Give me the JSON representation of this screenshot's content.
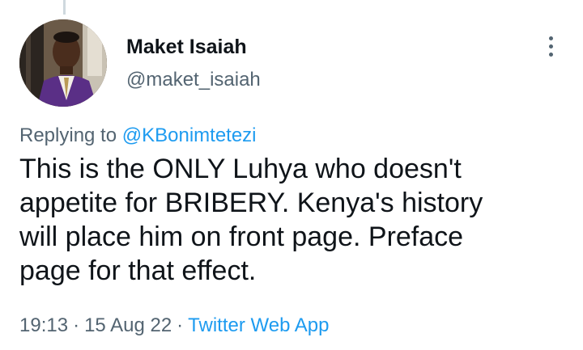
{
  "author": {
    "name": "Maket Isaiah",
    "handle": "@maket_isaiah"
  },
  "reply": {
    "prefix": "Replying to",
    "mention": "@KBonimtetezi"
  },
  "tweet": {
    "line1": "This is the ONLY Luhya who doesn't",
    "line2": "appetite for BRIBERY. Kenya's history",
    "line3": "will place him on front page. Preface",
    "line4": "page for that effect."
  },
  "meta": {
    "time": "19:13",
    "separator": "·",
    "date": "15 Aug 22",
    "source": "Twitter Web App"
  },
  "icons": {
    "more": "more-vertical-icon"
  },
  "colors": {
    "link": "#1d9bf0",
    "secondary_text": "#536471",
    "primary_text": "#0f1419"
  }
}
